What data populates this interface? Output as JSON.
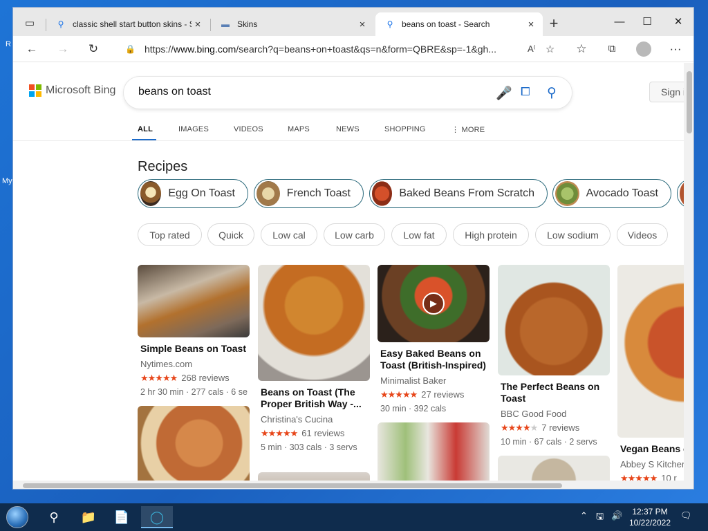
{
  "desktop": {
    "frag1": "R",
    "frag2": "My"
  },
  "tabs": [
    {
      "title": "classic shell start button skins - S",
      "close": "×"
    },
    {
      "title": "Skins",
      "close": "×"
    },
    {
      "title": "beans on toast - Search",
      "close": "×"
    }
  ],
  "tabbar": {
    "new_tab": "+"
  },
  "window_controls": {
    "minimize": "—",
    "maximize": "☐",
    "close": "✕"
  },
  "toolbar": {
    "back": "←",
    "forward": "→",
    "refresh": "↻",
    "url_prefix": "https://",
    "url_domain": "www.bing.com",
    "url_rest": "/search?q=beans+on+toast&qs=n&form=QBRE&sp=-1&gh...",
    "more": "···"
  },
  "brand": {
    "name": "Microsoft Bing",
    "colors": [
      "#f25022",
      "#7fba00",
      "#00a4ef",
      "#ffb900"
    ]
  },
  "search": {
    "query": "beans on toast",
    "mic": "mic-icon",
    "visual": "visual-search-icon",
    "search": "search-icon"
  },
  "signin": "Sign i",
  "scopes": [
    "ALL",
    "IMAGES",
    "VIDEOS",
    "MAPS",
    "NEWS",
    "SHOPPING",
    "⋮ MORE"
  ],
  "recipes_title": "Recipes",
  "recipe_pills": [
    {
      "label": "Egg On Toast"
    },
    {
      "label": "French Toast"
    },
    {
      "label": "Baked Beans From Scratch"
    },
    {
      "label": "Avocado Toast"
    }
  ],
  "filters": [
    "Top rated",
    "Quick",
    "Low cal",
    "Low carb",
    "Low fat",
    "High protein",
    "Low sodium",
    "Videos"
  ],
  "cards": [
    {
      "title": "Simple Beans on Toast",
      "source": "Nytimes.com",
      "stars": "★★★★★",
      "reviews": "268 reviews",
      "meta": "2 hr 30 min · 277 cals · 6 se"
    },
    {
      "title": "Beans on Toast (The Proper British Way -...",
      "source": "Christina's Cucina",
      "stars": "★★★★★",
      "reviews": "61 reviews",
      "meta": "5 min · 303 cals · 3 servs"
    },
    {
      "title": "Easy Baked Beans on Toast (British-Inspired)",
      "source": "Minimalist Baker",
      "stars": "★★★★★",
      "reviews": "27 reviews",
      "meta": "30 min · 392 cals"
    },
    {
      "title": "The Perfect Beans on Toast",
      "source": "BBC Good Food",
      "stars": "★★★★",
      "stars_off": "★",
      "reviews": "7 reviews",
      "meta": "10 min · 67 cals · 2 servs"
    },
    {
      "title": "Vegan Beans o",
      "source": "Abbey S Kitcher",
      "stars": "★★★★★",
      "reviews": "10 r"
    }
  ],
  "taskbar": {
    "time": "12:37 PM",
    "date": "10/22/2022"
  }
}
